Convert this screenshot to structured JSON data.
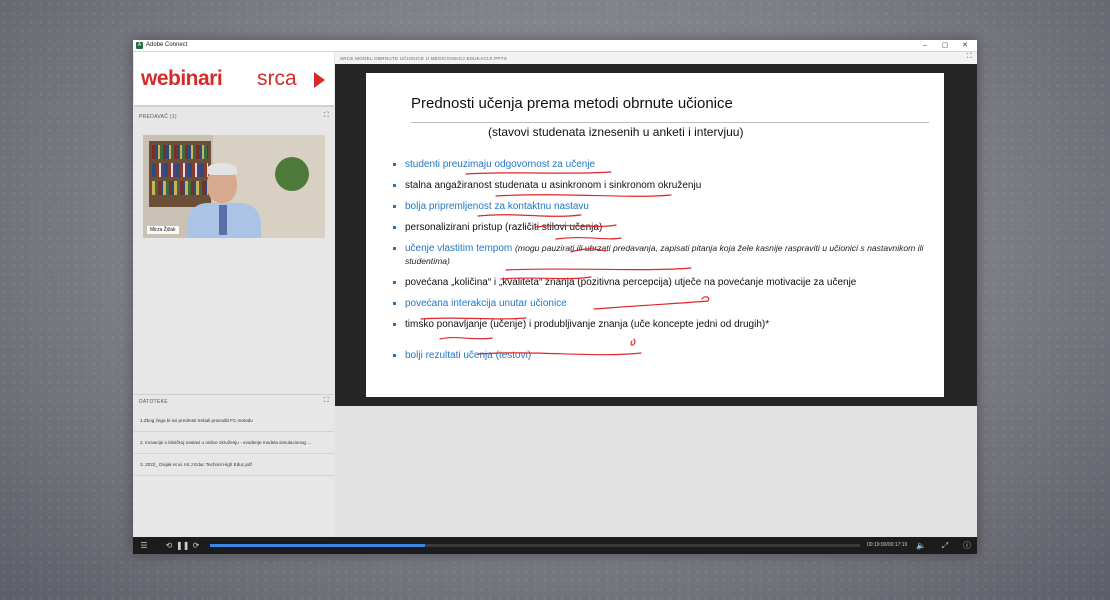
{
  "app": {
    "title": "Adobe Connect",
    "icon_letter": "A",
    "controls": [
      "–",
      "▢",
      "✕"
    ]
  },
  "logo": {
    "part1": "webinari",
    "part2": "srca"
  },
  "presenter_pod": {
    "header": "PREDAVAČ (1)",
    "name_tag": "Mirza Žižak"
  },
  "files_pod": {
    "header": "DATOTEKE",
    "files": [
      "1.Zbog čega bi svi predmeti trebali provoditi FC metodu",
      "2. Inovacije u kliničkoj nastavi u online okruženju - uvođenje modela simulacionog ...",
      "3. 2022_ Divjak et al. Int J Educ Technol High Educ.pdf"
    ]
  },
  "share_pod": {
    "header": "SRCE MODEL OBRNUTE UČIONICE U MEDICINSKOJ EDUKACIJI.PPTX"
  },
  "slide": {
    "title": "Prednosti učenja prema metodi obrnute učionice",
    "subtitle": "(stavovi studenata iznesenih u anketi i intervjuu)",
    "bullets": [
      {
        "text": "studenti preuzimaju odgovornost za učenje",
        "note": ""
      },
      {
        "text": "stalna angažiranost studenata u asinkronom i sinkronom okruženju",
        "note": ""
      },
      {
        "text": "bolja pripremljenost za kontaktnu nastavu",
        "note": ""
      },
      {
        "text": "personalizirani pristup (različiti stilovi učenja)",
        "note": ""
      },
      {
        "text": "učenje vlastitim tempom ",
        "note": "(mogu pauzirati ili ubrzati predavanja, zapisati pitanja koja žele kasnije raspraviti u učionici s nastavnikom ili studentima)"
      },
      {
        "text": "povećana „količina“ i „kvaliteta“ znanja (pozitivna percepcija) utječe na povećanje motivacije za učenje",
        "note": ""
      },
      {
        "text": "povećana interakcija unutar učionice",
        "note": ""
      },
      {
        "text": "timsko ponavljanje (učenje) i produbljivanje znanja  (uče koncepte jedni od drugih)*",
        "note": ""
      },
      {
        "text": "bolji rezultati učenja (testovi)",
        "note": ""
      }
    ]
  },
  "player": {
    "time": "00:19:00/00:17:19",
    "progress": 0.33,
    "progress_color": "#3b87e6"
  },
  "colors": {
    "brand_red": "#d62b2b",
    "bullet_blue": "#1f77c9",
    "ink_red": "#e0262b"
  },
  "icons": [
    "menu-icon",
    "rewind-icon",
    "pause-icon",
    "forward-icon",
    "volume-icon",
    "fullscreen-icon",
    "info-icon",
    "expand-icon"
  ]
}
